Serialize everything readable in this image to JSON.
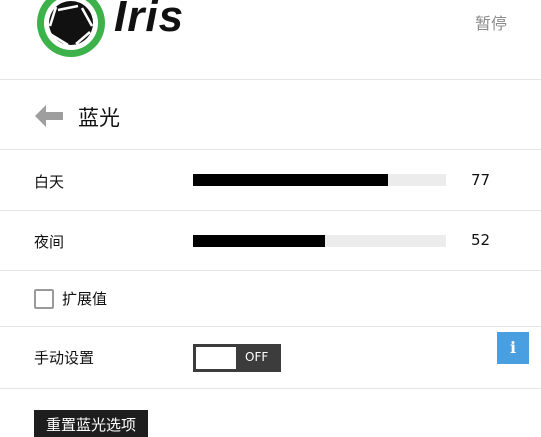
{
  "header": {
    "app_name": "Iris",
    "pause_label": "暂停"
  },
  "page": {
    "title": "蓝光"
  },
  "settings": {
    "day": {
      "label": "白天",
      "value": "77",
      "fraction": 0.77
    },
    "night": {
      "label": "夜间",
      "value": "52",
      "fraction": 0.52
    },
    "extended_values": {
      "label": "扩展值",
      "checked": false
    },
    "manual": {
      "label": "手动设置",
      "toggle_text": "OFF"
    }
  },
  "info_button": {
    "label": "i"
  },
  "reset_button": {
    "label": "重置蓝光选项"
  },
  "icons": [
    "aperture-logo-icon",
    "back-arrow-icon",
    "info-icon"
  ],
  "colors": {
    "logo_green": "#3db24a",
    "slider_fill": "#000000",
    "slider_track": "#ececec",
    "info_blue": "#4a9fe0",
    "button_dark": "#1e1e1e"
  }
}
